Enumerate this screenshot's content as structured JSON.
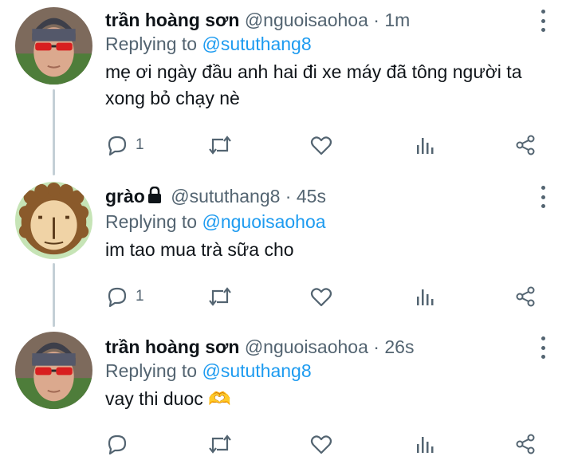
{
  "colors": {
    "text": "#0f1419",
    "muted": "#536471",
    "link": "#1d9bf0",
    "thread_line": "#c4cfd6"
  },
  "tweets": [
    {
      "display_name": "trần hoàng sơn",
      "handle": "@nguoisaohoa",
      "separator": "·",
      "time": "1m",
      "replying_label": "Replying to",
      "replying_handle": "@sututhang8",
      "text": "mẹ ơi ngày đầu anh hai đi xe máy đã tông người ta xong bỏ chạy nè",
      "reply_count": "1",
      "avatar_icon": "person-avatar-icon"
    },
    {
      "display_name": "grào",
      "protected_icon": "lock-icon",
      "handle": "@sututhang8",
      "separator": "·",
      "time": "45s",
      "replying_label": "Replying to",
      "replying_handle": "@nguoisaohoa",
      "text": "im tao mua trà sữa cho",
      "reply_count": "1",
      "avatar_icon": "lion-avatar-icon"
    },
    {
      "display_name": "trần hoàng sơn",
      "handle": "@nguoisaohoa",
      "separator": "·",
      "time": "26s",
      "replying_label": "Replying to",
      "replying_handle": "@sututhang8",
      "text": "vay thi duoc",
      "emoji": "🫶",
      "reply_count": "",
      "avatar_icon": "person-avatar-icon"
    }
  ],
  "action_icons": [
    "reply-icon",
    "retweet-icon",
    "like-icon",
    "views-icon",
    "share-icon"
  ]
}
